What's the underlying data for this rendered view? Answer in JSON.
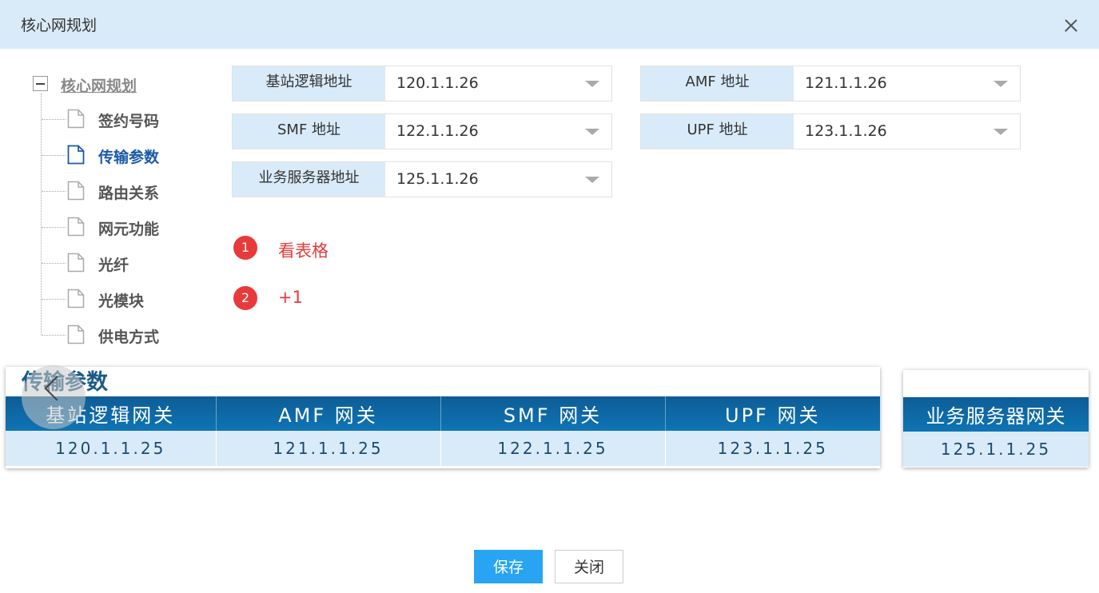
{
  "window": {
    "title": "核心网规划"
  },
  "tree": {
    "root": "核心网规划",
    "items": [
      {
        "label": "签约号码",
        "active": false
      },
      {
        "label": "传输参数",
        "active": true
      },
      {
        "label": "路由关系",
        "active": false
      },
      {
        "label": "网元功能",
        "active": false
      },
      {
        "label": "光纤",
        "active": false
      },
      {
        "label": "光模块",
        "active": false
      },
      {
        "label": "供电方式",
        "active": false
      }
    ]
  },
  "form": {
    "fields": [
      {
        "label": "基站逻辑地址",
        "value": "120.1.1.26"
      },
      {
        "label": "AMF 地址",
        "value": "121.1.1.26"
      },
      {
        "label": "SMF 地址",
        "value": "122.1.1.26"
      },
      {
        "label": "UPF 地址",
        "value": "123.1.1.26"
      },
      {
        "label": "业务服务器地址",
        "value": "125.1.1.26"
      }
    ]
  },
  "annotations": [
    {
      "number": "1",
      "text": "看表格"
    },
    {
      "number": "2",
      "text": "+1"
    }
  ],
  "reference": {
    "title": "传输参数",
    "table1": {
      "headers": [
        "基站逻辑网关",
        "AMF 网关",
        "SMF 网关",
        "UPF 网关"
      ],
      "values": [
        "120.1.1.25",
        "121.1.1.25",
        "122.1.1.25",
        "123.1.1.25"
      ]
    },
    "table2": {
      "headers": [
        "业务服务器网关"
      ],
      "values": [
        "125.1.1.25"
      ]
    }
  },
  "buttons": {
    "save": "保存",
    "close": "关闭"
  },
  "colors": {
    "header_bg": "#d9ebf9",
    "accent": "#28a4f2",
    "annotation": "#e83a3a",
    "table_header": "#0f74b4"
  }
}
